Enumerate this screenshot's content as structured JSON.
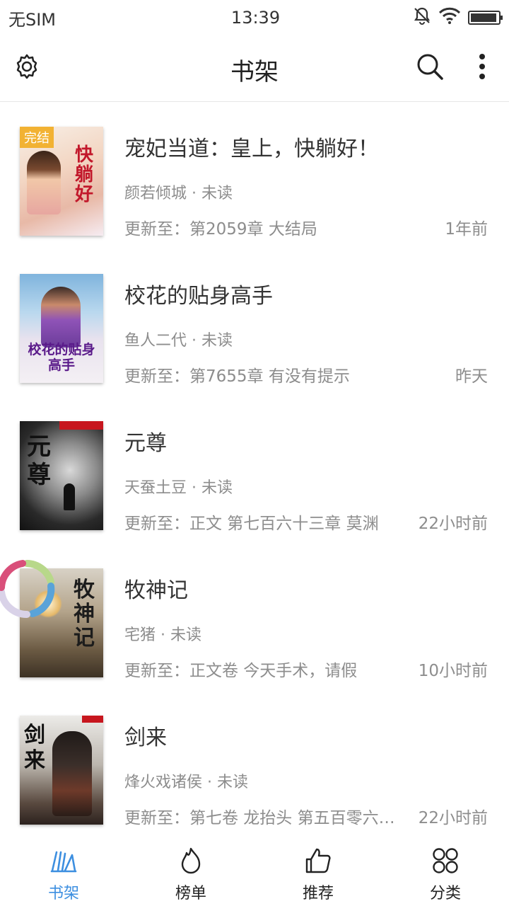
{
  "status_bar": {
    "carrier": "无SIM",
    "time": "13:39",
    "battery_level": 0.95
  },
  "app_bar": {
    "title": "书架"
  },
  "colors": {
    "accent": "#3d8fe0",
    "badge": "#f2b233",
    "text_primary": "#333333",
    "text_secondary": "#8d8d8d"
  },
  "books": [
    {
      "title": "宠妃当道：皇上，快躺好！",
      "author": "颜若倾城",
      "status": "未读",
      "update": "更新至：第2059章 大结局",
      "time": "1年前",
      "badge": "完结",
      "cover_text": "快躺好"
    },
    {
      "title": "校花的贴身高手",
      "author": "鱼人二代",
      "status": "未读",
      "update": "更新至：第7655章 有没有提示",
      "time": "昨天",
      "cover_text": "校花的贴身高手"
    },
    {
      "title": "元尊",
      "author": "天蚕土豆",
      "status": "未读",
      "update": "更新至：正文 第七百六十三章 莫渊",
      "time": "22小时前",
      "cover_text": "元尊"
    },
    {
      "title": "牧神记",
      "author": "宅猪",
      "status": "未读",
      "update": "更新至：正文卷 今天手术，请假",
      "time": "10小时前",
      "cover_text": "牧神记"
    },
    {
      "title": "剑来",
      "author": "烽火戏诸侯",
      "status": "未读",
      "update": "更新至：第七卷 龙抬头 第五百零六…",
      "time": "22小时前",
      "cover_text": "剑来"
    }
  ],
  "bottom_nav": [
    {
      "label": "书架",
      "icon": "bookshelf-icon",
      "active": true
    },
    {
      "label": "榜单",
      "icon": "flame-icon",
      "active": false
    },
    {
      "label": "推荐",
      "icon": "thumbs-up-icon",
      "active": false
    },
    {
      "label": "分类",
      "icon": "category-icon",
      "active": false
    }
  ]
}
